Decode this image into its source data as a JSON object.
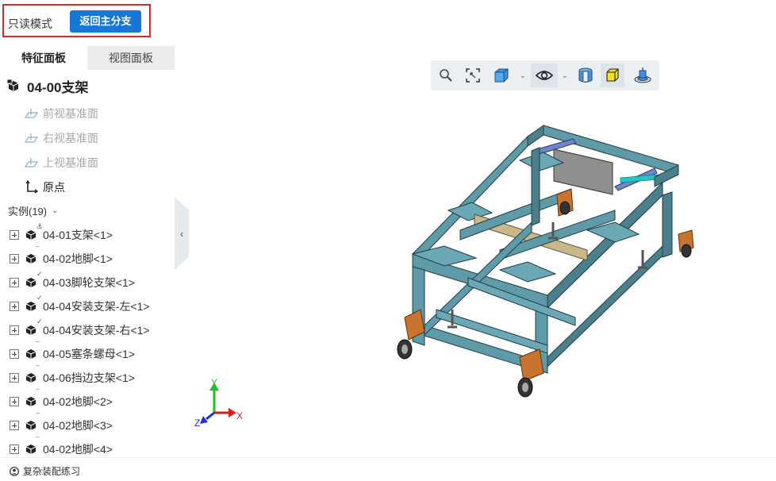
{
  "header": {
    "mode_label": "只读模式",
    "back_button_label": "返回主分支"
  },
  "sidebar": {
    "tabs": [
      {
        "label": "特征面板",
        "active": true
      },
      {
        "label": "视图面板",
        "active": false
      }
    ],
    "root": {
      "label": "04-00支架",
      "icon": "assembly-icon"
    },
    "planes": [
      {
        "label": "前视基准面",
        "icon": "plane-icon"
      },
      {
        "label": "右视基准面",
        "icon": "plane-icon"
      },
      {
        "label": "上视基准面",
        "icon": "plane-icon"
      }
    ],
    "origin": {
      "label": "原点",
      "icon": "origin-icon"
    },
    "instances_header": "实例(19)",
    "instances": [
      {
        "label": "04-01支架<1>",
        "mark": "anchor"
      },
      {
        "label": "04-02地脚<1>",
        "mark": "dash"
      },
      {
        "label": "04-03脚轮支架<1>",
        "mark": "check"
      },
      {
        "label": "04-04安装支架-左<1>",
        "mark": "check"
      },
      {
        "label": "04-04安装支架-右<1>",
        "mark": "check"
      },
      {
        "label": "04-05塞条螺母<1>",
        "mark": "dash"
      },
      {
        "label": "04-06挡边支架<1>",
        "mark": "dash"
      },
      {
        "label": "04-02地脚<2>",
        "mark": "dash"
      },
      {
        "label": "04-02地脚<3>",
        "mark": "dash"
      },
      {
        "label": "04-02地脚<4>",
        "mark": "dash"
      }
    ]
  },
  "toolbar": {
    "buttons": [
      {
        "icon": "zoom-icon"
      },
      {
        "icon": "fit-view-icon"
      },
      {
        "icon": "view-cube-icon"
      },
      {
        "icon": "eye-visibility-icon"
      },
      {
        "icon": "section-view-icon"
      },
      {
        "icon": "shaded-display-icon"
      },
      {
        "icon": "exploded-view-icon"
      }
    ]
  },
  "axes": {
    "x": "X",
    "y": "Y",
    "z": "Z"
  },
  "footer": {
    "user_label": "复杂装配练习"
  },
  "colors": {
    "accent": "#1677d4",
    "highlight_border": "#e0242b",
    "model_steel": "#5f9aa8",
    "model_orange": "#c9742e",
    "model_beam": "#c8b88a"
  }
}
